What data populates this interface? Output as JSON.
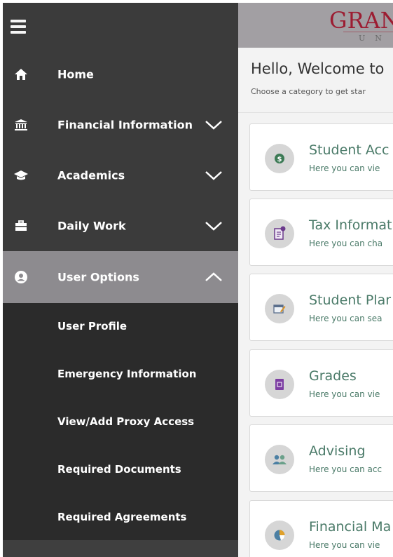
{
  "sidebar": {
    "items": [
      {
        "label": "Home",
        "icon": "home-icon"
      },
      {
        "label": "Financial Information",
        "icon": "bank-icon"
      },
      {
        "label": "Academics",
        "icon": "graduation-cap-icon"
      },
      {
        "label": "Daily Work",
        "icon": "briefcase-icon"
      },
      {
        "label": "User Options",
        "icon": "user-circle-icon",
        "expanded": true
      }
    ],
    "sub_items": [
      {
        "label": "User Profile"
      },
      {
        "label": "Emergency Information"
      },
      {
        "label": "View/Add Proxy Access"
      },
      {
        "label": "Required Documents"
      },
      {
        "label": "Required Agreements"
      }
    ]
  },
  "header": {
    "brand": "GRAN",
    "brand_sub": "UN"
  },
  "main": {
    "welcome": "Hello, Welcome to",
    "hint": "Choose a category to get star",
    "cards": [
      {
        "title": "Student Acc",
        "desc": "Here you can vie",
        "icon": "dollar-icon"
      },
      {
        "title": "Tax Informat",
        "desc": "Here you can cha",
        "icon": "tax-document-icon"
      },
      {
        "title": "Student Plar",
        "desc": "Here you can sea",
        "icon": "planner-icon"
      },
      {
        "title": "Grades",
        "desc": "Here you can vie",
        "icon": "grades-book-icon"
      },
      {
        "title": "Advising",
        "desc": "Here you can acc",
        "icon": "advisors-icon"
      },
      {
        "title": "Financial Ma",
        "desc": "Here you can vie",
        "icon": "pie-chart-icon"
      }
    ]
  },
  "colors": {
    "sidebar_bg": "#3b3b3b",
    "active_bg": "#8d8b8f",
    "submenu_bg": "#2b2b2b",
    "brand": "#9c1d32",
    "card_text": "#4a7a68"
  }
}
